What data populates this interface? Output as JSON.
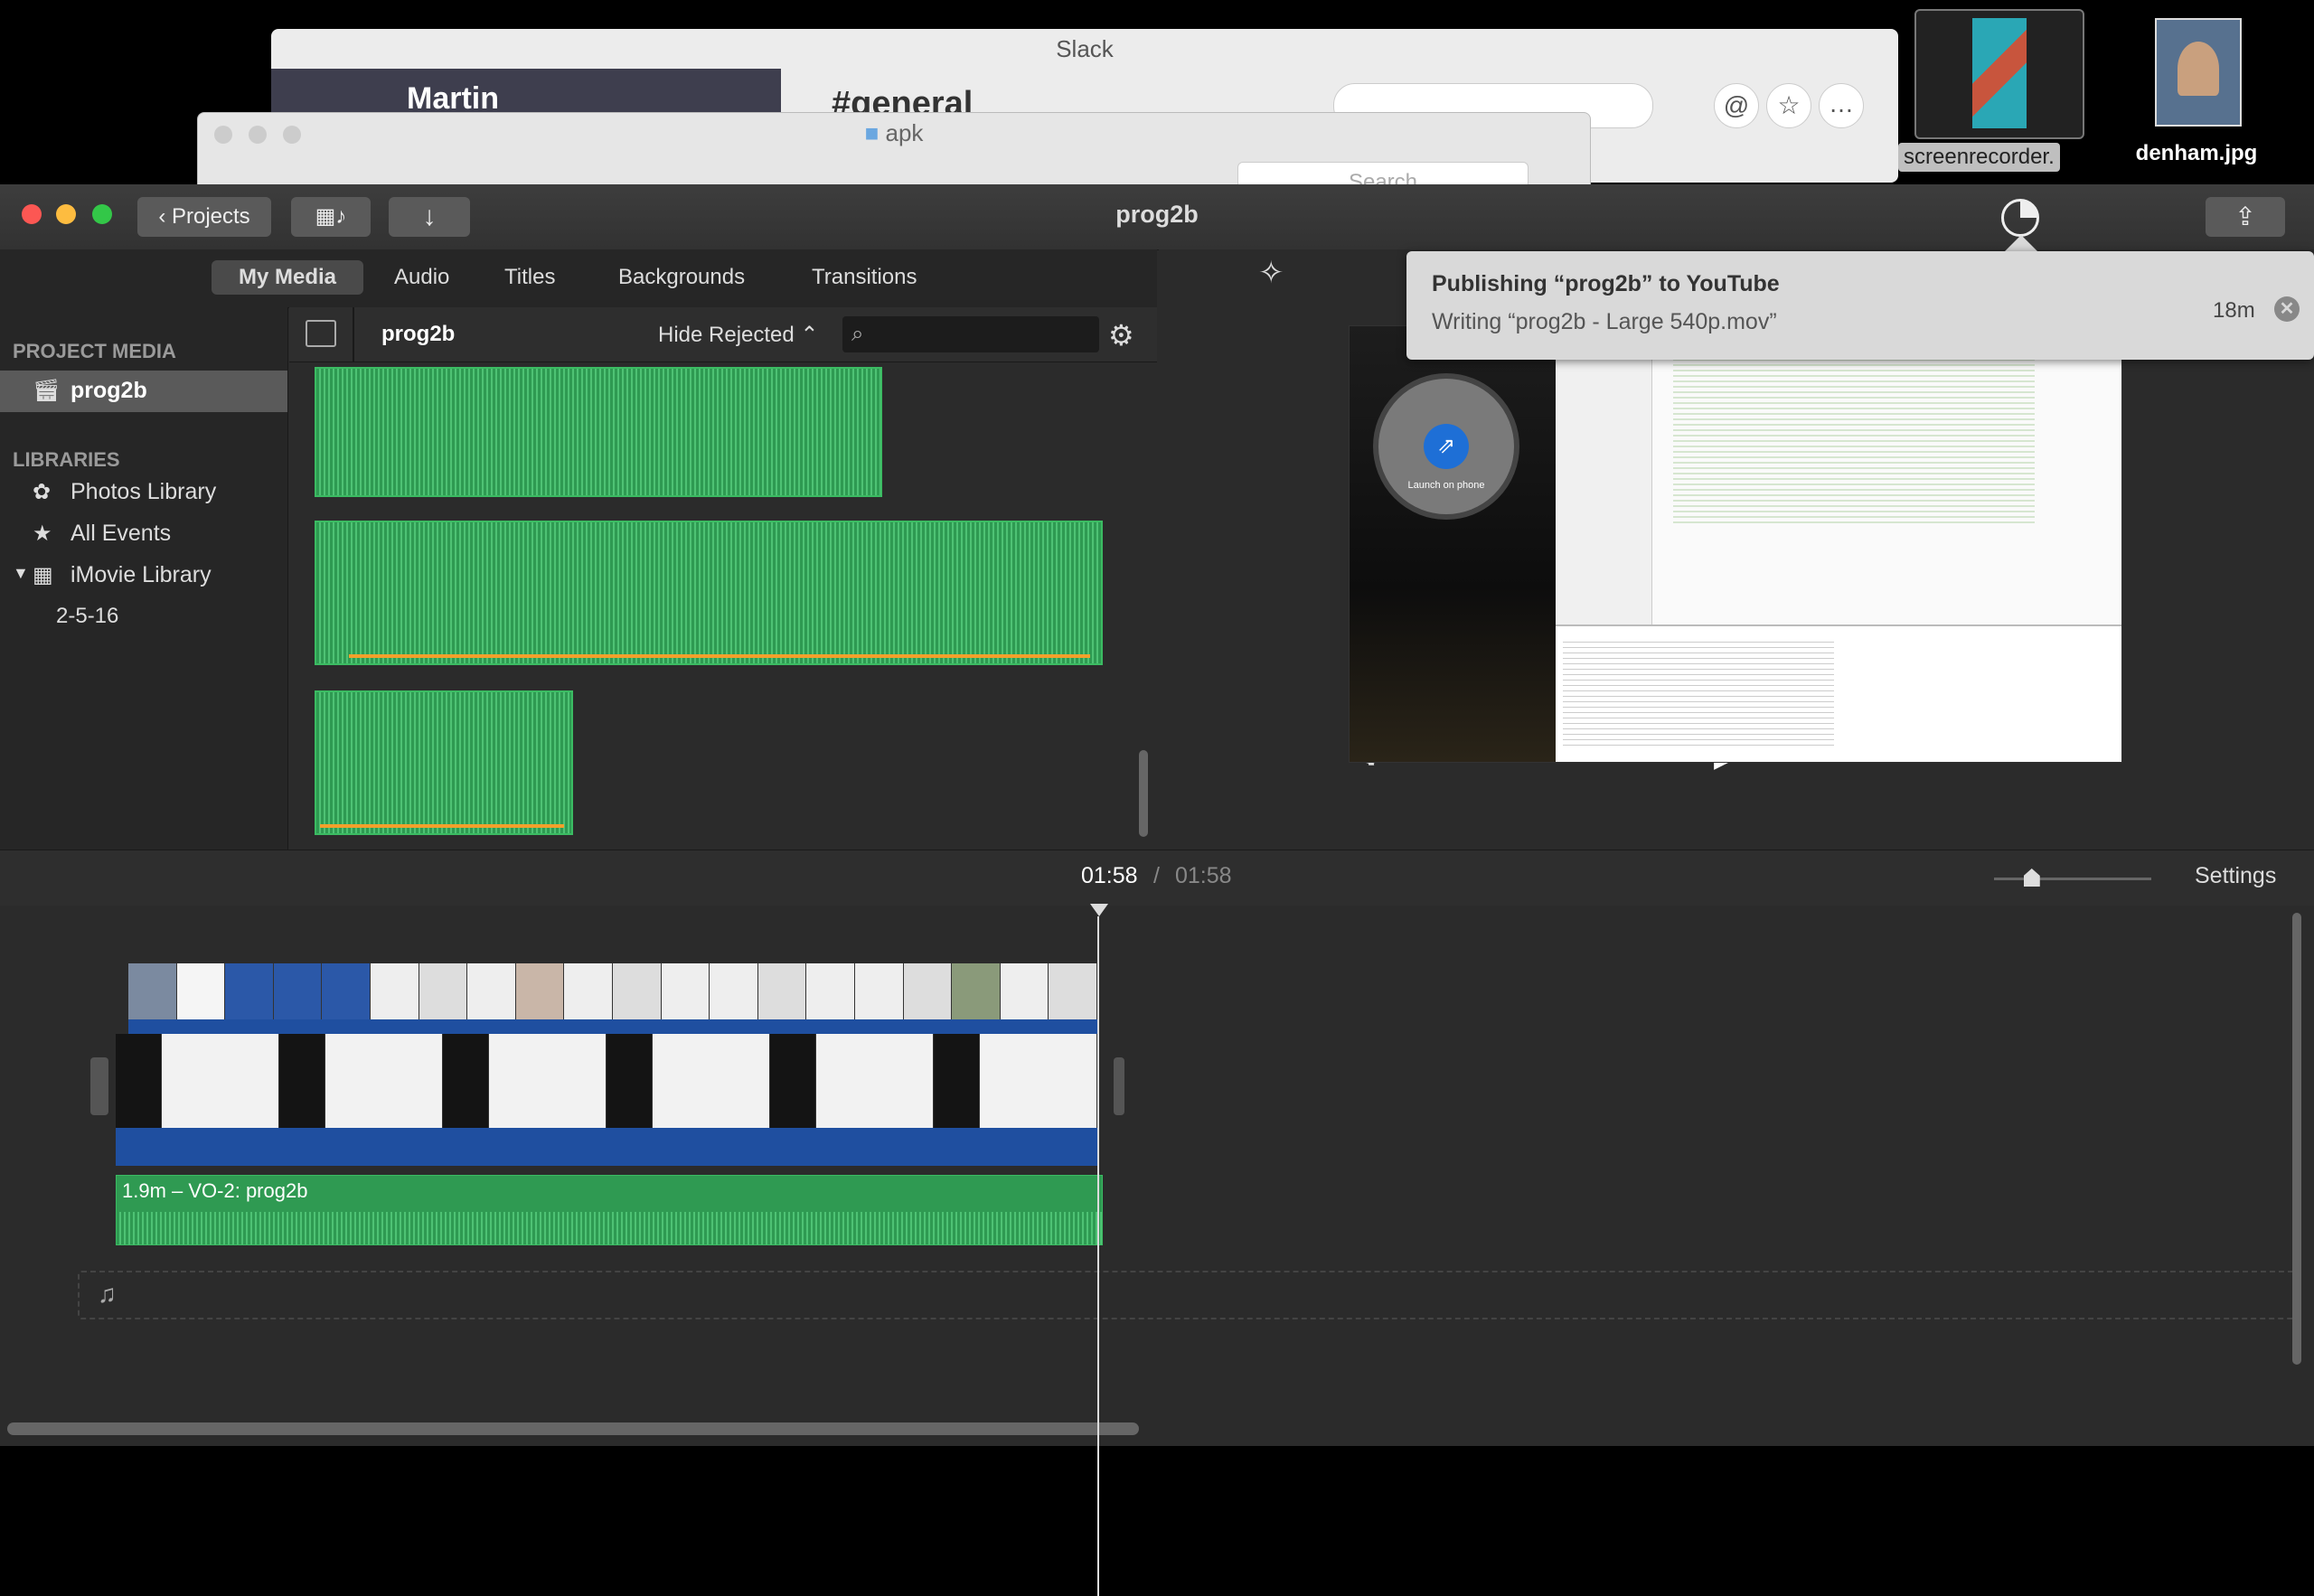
{
  "background": {
    "slack_title": "Slack",
    "slack_channel": "#general",
    "slack_workspace": "Martin",
    "finder_title": "apk",
    "finder_search": "Search"
  },
  "desktop": {
    "thumb_label": "screenrecorder.",
    "file_label": "denham.jpg"
  },
  "window": {
    "title": "prog2b",
    "projects_button": "Projects"
  },
  "tabs": [
    "My Media",
    "Audio",
    "Titles",
    "Backgrounds",
    "Transitions"
  ],
  "sidebar": {
    "project_media_header": "PROJECT MEDIA",
    "project_item": "prog2b",
    "libraries_header": "LIBRARIES",
    "items": [
      "Photos Library",
      "All Events",
      "iMovie Library"
    ],
    "event": "2-5-16"
  },
  "browser": {
    "title": "prog2b",
    "filter": "Hide Rejected",
    "search_placeholder": ""
  },
  "notification": {
    "title": "Publishing “prog2b” to YouTube",
    "detail": "Writing “prog2b - Large 540p.mov”",
    "time": "18m"
  },
  "viewer": {
    "launch_label": "Launch on phone"
  },
  "timebar": {
    "current": "01:58",
    "separator": "/",
    "total": "01:58",
    "settings": "Settings",
    "zoom_level": 0.24
  },
  "timeline": {
    "audio_label": "1.9m – VO-2: prog2b"
  },
  "icons": {
    "close": "#fc5753",
    "minimize": "#fdbc40",
    "zoom": "#33c748",
    "accent_green": "#2f9a52",
    "clip_blue": "#1f4fa0"
  }
}
